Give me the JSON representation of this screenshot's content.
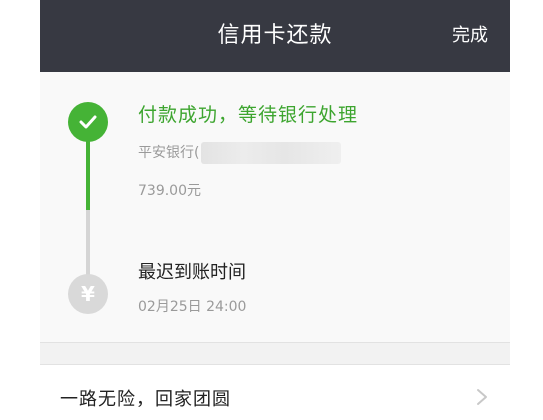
{
  "navbar": {
    "title": "信用卡还款",
    "done_label": "完成"
  },
  "status": {
    "title": "付款成功，等待银行处理",
    "bank": "平安银行(",
    "amount": "739.00元"
  },
  "deadline": {
    "label": "最迟到账时间",
    "time": "02月25日 24:00",
    "icon_glyph": "¥"
  },
  "promo": {
    "text": "一路无险，回家团圆"
  },
  "colors": {
    "navbar_bg": "#373942",
    "success_green": "#45b336",
    "pending_gray": "#d9d9d9",
    "secondary_text": "#9a9a9a"
  },
  "icons": {
    "success": "check-circle-icon",
    "pending": "yen-circle-icon",
    "chevron": "chevron-right-icon"
  }
}
